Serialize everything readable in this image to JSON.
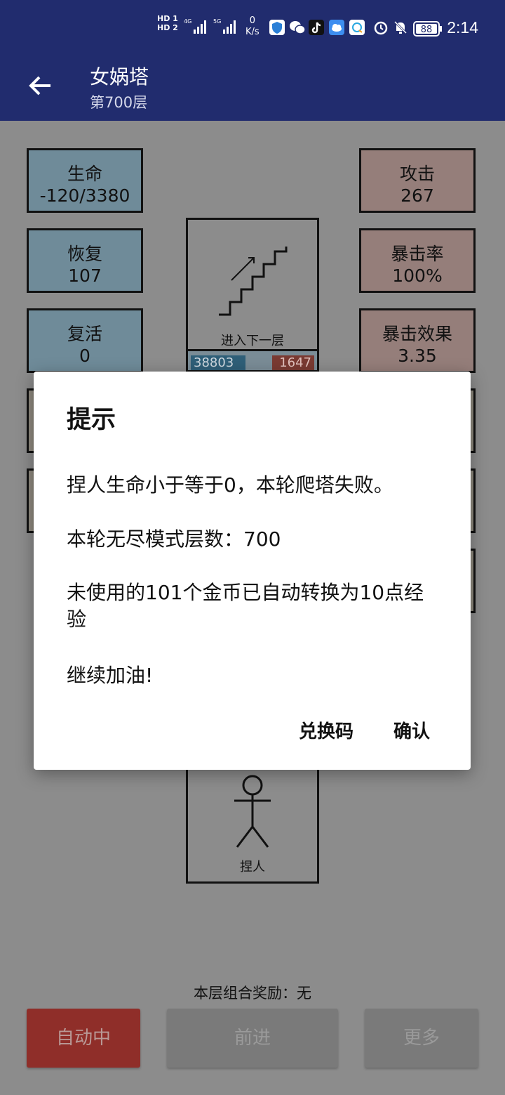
{
  "status_bar": {
    "hd1": "HD 1",
    "hd2": "HD 2",
    "net_a": "4G",
    "net_b": "5G",
    "speed_value": "0",
    "speed_unit": "K/s",
    "battery": "88",
    "time": "2:14"
  },
  "app_bar": {
    "title": "女娲塔",
    "subtitle": "第700层"
  },
  "stats_left": [
    {
      "label": "生命",
      "value": "-120/3380"
    },
    {
      "label": "恢复",
      "value": "107"
    },
    {
      "label": "复活",
      "value": "0"
    }
  ],
  "stats_right": [
    {
      "label": "攻击",
      "value": "267"
    },
    {
      "label": "暴击率",
      "value": "100%"
    },
    {
      "label": "暴击效果",
      "value": "3.35"
    }
  ],
  "center": {
    "stairs_label": "进入下一层",
    "bar_left": "38803",
    "bar_right": "1647",
    "person_label": "捏人"
  },
  "reward_text": "本层组合奖励：无",
  "buttons": {
    "auto": "自动中",
    "next": "前进",
    "more": "更多"
  },
  "dialog": {
    "title": "提示",
    "line1": "捏人生命小于等于0，本轮爬塔失败。",
    "line2": "本轮无尽模式层数：700",
    "line3": "未使用的101个金币已自动转换为10点经验",
    "line4": "继续加油!",
    "btn_code": "兑换码",
    "btn_ok": "确认"
  },
  "colors": {
    "app_bar": "#212c6e",
    "dim_background": "#8c8c8c",
    "auto_button": "#8f2e29"
  }
}
